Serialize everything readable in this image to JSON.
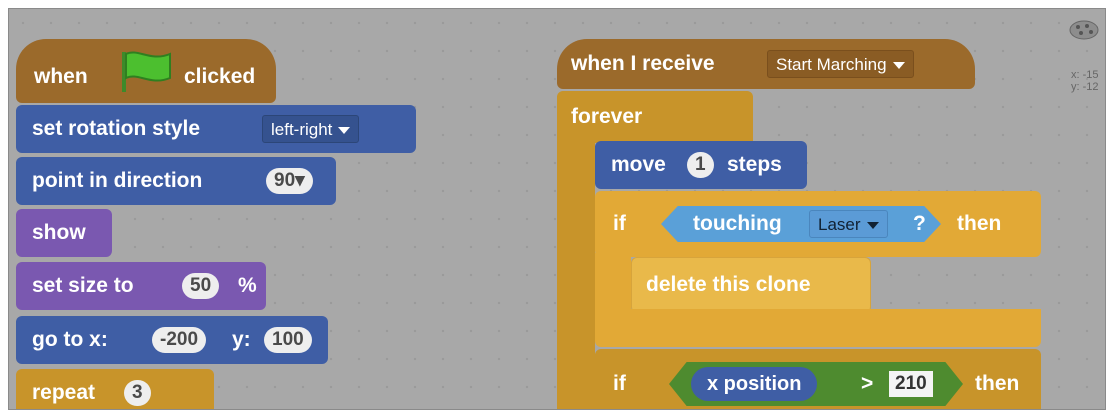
{
  "left_script": {
    "hat": {
      "when": "when",
      "clicked": "clicked"
    },
    "rotation": {
      "label": "set rotation style",
      "value": "left-right"
    },
    "direction": {
      "label": "point in direction",
      "value": "90▾"
    },
    "show": {
      "label": "show"
    },
    "size": {
      "label": "set size to",
      "value": "50",
      "unit": "%"
    },
    "goto": {
      "label": "go to x:",
      "x": "-200",
      "ylabel": "y:",
      "y": "100"
    },
    "repeat": {
      "label": "repeat",
      "value": "3"
    }
  },
  "right_script": {
    "receive": {
      "label": "when I receive",
      "message": "Start Marching"
    },
    "forever": {
      "label": "forever"
    },
    "move": {
      "label": "move",
      "value": "1",
      "unit": "steps"
    },
    "if1": {
      "if": "if",
      "touching": "touching",
      "target": "Laser",
      "q": "?",
      "then": "then"
    },
    "delete": {
      "label": "delete this clone"
    },
    "if2": {
      "if": "if",
      "reporter": "x position",
      "op": ">",
      "value": "210",
      "then": "then"
    }
  },
  "sprite_info": {
    "x": "x: -15",
    "y": "y: -12"
  },
  "colors": {
    "motion": "#3f5ea5",
    "looks": "#7a58b0",
    "events": "#9b6a2b",
    "control": "#e2a936",
    "operators": "#4e8b2f",
    "sensing": "#5aa0d8"
  }
}
